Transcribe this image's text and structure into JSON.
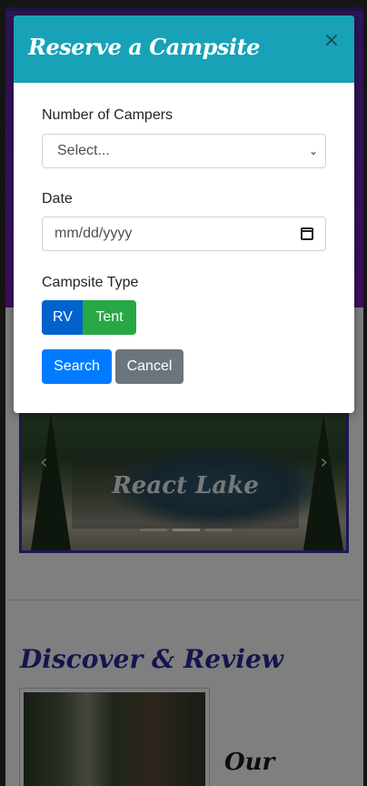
{
  "background_page": {
    "carousel": {
      "caption": "React Lake",
      "prev_glyph": "‹",
      "next_glyph": "›",
      "indicator_count": 3,
      "active_indicator": 2
    },
    "section_heading": "Discover & Review",
    "card_title": "Our"
  },
  "modal": {
    "title": "Reserve a Campsite",
    "close_glyph": "×",
    "campers_label": "Number of Campers",
    "campers_select_value": "Select...",
    "date_label": "Date",
    "date_placeholder": "mm/dd/yyyy",
    "campsite_type_label": "Campsite Type",
    "campsite_types": [
      "RV",
      "Tent"
    ],
    "search_button": "Search",
    "cancel_button": "Cancel"
  },
  "colors": {
    "modal_header": "#17a2b8",
    "rv_button": "#0062cc",
    "tent_button": "#28a745",
    "search_button": "#007bff",
    "cancel_button": "#6c757d",
    "heading_accent": "#2a2a9e"
  },
  "icons": {
    "close": "close-icon",
    "select_chevron": "chevron-down-icon",
    "date_picker": "calendar-icon"
  }
}
